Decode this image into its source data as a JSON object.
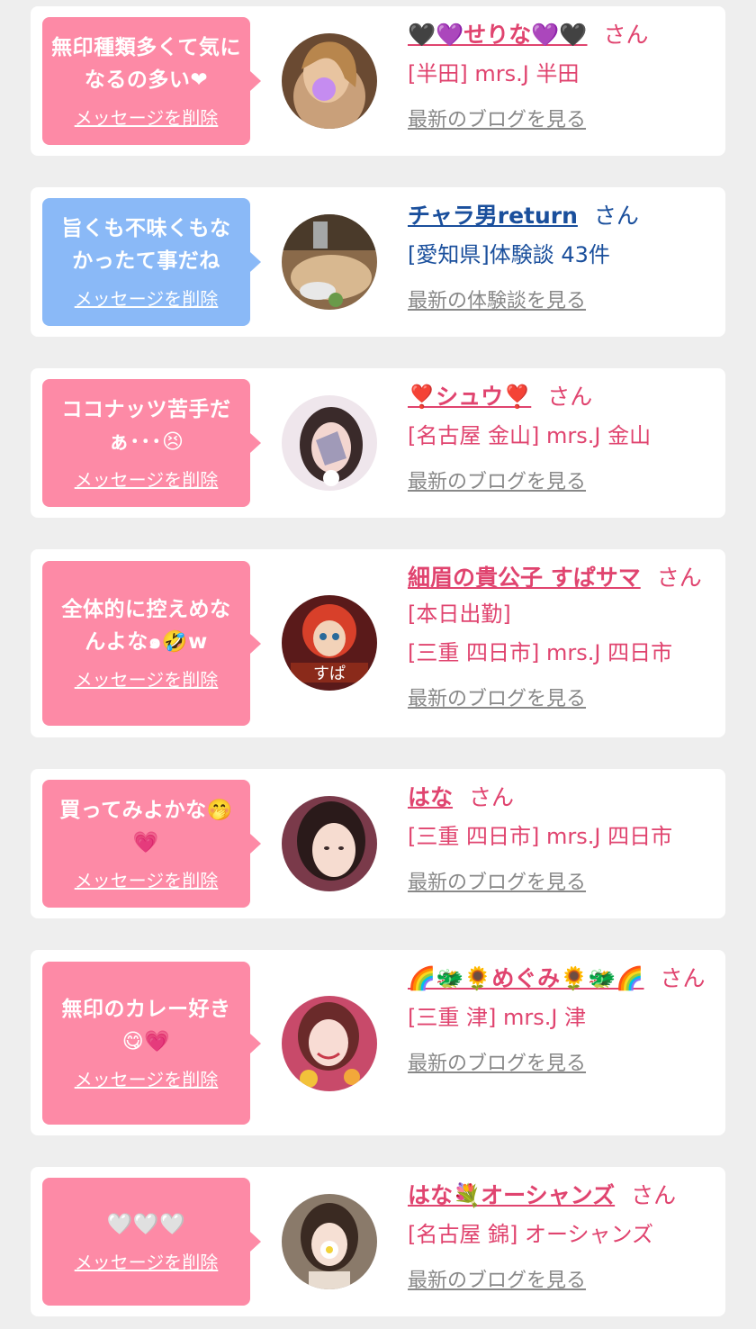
{
  "messages": [
    {
      "bubble_text": "無印種類多くて気になるの多い❤",
      "delete_label": "メッセージを削除",
      "name": "🖤💜せりな💜🖤",
      "san": "さん",
      "shop": "[半田] mrs.J 半田",
      "more": "最新のブログを見る",
      "color": "pink"
    },
    {
      "bubble_text": "旨くも不味くもなかったて事だね",
      "delete_label": "メッセージを削除",
      "name": "チャラ男return",
      "san": "さん",
      "shop": "[愛知県]体験談 43件",
      "more": "最新の体験談を見る",
      "color": "blue"
    },
    {
      "bubble_text": "ココナッツ苦手だぁ･･･😣",
      "delete_label": "メッセージを削除",
      "name": "❣️シュウ❣️",
      "san": "さん",
      "shop": "[名古屋 金山] mrs.J 金山",
      "more": "最新のブログを見る",
      "color": "pink"
    },
    {
      "bubble_text": "全体的に控えめなんよな๑🤣w",
      "delete_label": "メッセージを削除",
      "name": "細眉の貴公子 すぱサマ",
      "san": "さん",
      "status": "[本日出勤]",
      "shop": "[三重 四日市] mrs.J 四日市",
      "more": "最新のブログを見る",
      "color": "pink"
    },
    {
      "bubble_text": "買ってみよかな🤭💗",
      "delete_label": "メッセージを削除",
      "name": "はな",
      "san": "さん",
      "shop": "[三重 四日市] mrs.J 四日市",
      "more": "最新のブログを見る",
      "color": "pink"
    },
    {
      "bubble_text": "無印のカレー好き😋💗",
      "delete_label": "メッセージを削除",
      "name": "🌈🐲🌻めぐみ🌻🐲🌈",
      "san": "さん",
      "shop": "[三重 津] mrs.J 津",
      "more": "最新のブログを見る",
      "color": "pink"
    },
    {
      "bubble_text": "🤍🤍🤍",
      "delete_label": "メッセージを削除",
      "name": "はな💐オーシャンズ",
      "san": "さん",
      "shop": "[名古屋 錦] オーシャンズ",
      "more": "最新のブログを見る",
      "color": "pink"
    }
  ]
}
